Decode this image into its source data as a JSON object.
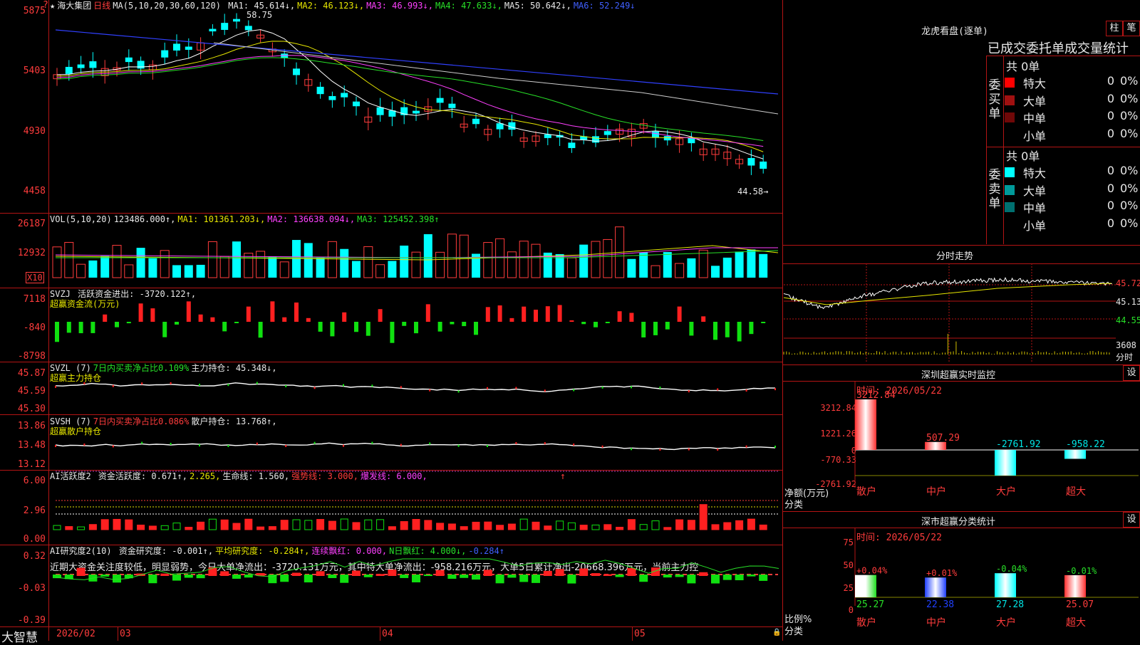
{
  "header_main": {
    "star": "★",
    "stock_name": "海大集团",
    "period": "日线",
    "ma_label": "MA(5,10,20,30,60,120)",
    "ma1": "MA1: 45.614↓,",
    "ma2": "MA2: 46.123↓,",
    "ma3": "MA3: 46.993↓,",
    "ma4": "MA4: 47.633↓,",
    "ma5": "MA5: 50.642↓,",
    "ma6": "MA6: 52.249↓",
    "high_mark": "58.75",
    "low_mark": "44.58→"
  },
  "main_axis": [
    "5875",
    "5403",
    "4930",
    "4458"
  ],
  "vol": {
    "label": "VOL(5,10,20)",
    "value": "123486.000↑,",
    "ma1": "MA1: 101361.203↓,",
    "ma2": "MA2: 136638.094↓,",
    "ma3": "MA3: 125452.398↑",
    "axis": [
      "26187",
      "12932"
    ],
    "unit": "X10"
  },
  "svzj": {
    "label": "SVZJ",
    "line1": "活跃资金进出: -3720.122↑,",
    "line2": "超赢资金流(万元)",
    "axis": [
      "7118",
      "-840",
      "-8798"
    ]
  },
  "svzl": {
    "label": "SVZL (7)",
    "pct": "7日内买卖净占比0.109%",
    "hold": "主力持仓: 45.348↓,",
    "line2": "超赢主力持仓",
    "axis": [
      "45.87",
      "45.59",
      "45.30"
    ]
  },
  "svsh": {
    "label": "SVSH (7)",
    "pct": "7日内买卖净占比0.086%",
    "hold": "散户持仓: 13.768↑,",
    "line2": "超赢散户持仓",
    "axis": [
      "13.86",
      "13.48",
      "13.12"
    ]
  },
  "ai1": {
    "label": "AI活跃度2",
    "v1": "资金活跃度: 0.671↑,",
    "v2": "2.265,",
    "v3": "生命线: 1.560,",
    "v4": "强势线: 3.000,",
    "v5": "爆发线: 6.000,",
    "arrow": "↑",
    "axis": [
      "6.00",
      "2.96",
      "0.00"
    ]
  },
  "ai2": {
    "label": "AI研究度2(10)",
    "v1": "资金研究度: -0.001↑,",
    "v2": "平均研究度: -0.284↑,",
    "v3": "连续飘红: 0.000,",
    "v4": "N日飘红: 4.000↓,",
    "v5": "-0.284↑",
    "sentence": "近期大资金关注度较低，明显弱势，今日大单净流出：-3720.131万元，其中特大单净流出：-958.216万元，大单5日累计净出-20668.396万元，当前主力控",
    "axis": [
      "0.32",
      "-0.03",
      "-0.39"
    ]
  },
  "bottom": {
    "brand": "大智慧",
    "d1": "2026/02",
    "d2": "03",
    "d3": "04",
    "d4": "05",
    "lock": "🔒"
  },
  "lhb": {
    "title": "龙虎看盘(逐单)",
    "btn1": "柱",
    "btn2": "笔",
    "subtitle": "已成交委托单成交量统计",
    "buy_total": "共 0单",
    "buy_label": "委买单",
    "buy_rows": [
      {
        "name": "特大",
        "v": "0",
        "pct": "0%",
        "color": "#ff0000"
      },
      {
        "name": "大单",
        "v": "0",
        "pct": "0%",
        "color": "#a01010"
      },
      {
        "name": "中单",
        "v": "0",
        "pct": "0%",
        "color": "#700808"
      },
      {
        "name": "小单",
        "v": "0",
        "pct": "0%",
        "color": "#000000"
      }
    ],
    "sell_total": "共 0单",
    "sell_label": "委卖单",
    "sell_rows": [
      {
        "name": "特大",
        "v": "0",
        "pct": "0%",
        "color": "#00ffff"
      },
      {
        "name": "大单",
        "v": "0",
        "pct": "0%",
        "color": "#009a9a"
      },
      {
        "name": "中单",
        "v": "0",
        "pct": "0%",
        "color": "#007070"
      },
      {
        "name": "小单",
        "v": "0",
        "pct": "0%",
        "color": "#000000"
      }
    ]
  },
  "fenshi": {
    "title": "分时走势",
    "axis": [
      "45.72",
      "45.13",
      "44.55"
    ],
    "vol_label1": "3608",
    "vol_label2": "分时"
  },
  "monitor": {
    "title": "深圳超赢实时监控",
    "btn": "设",
    "time": "时间: 2026/05/22",
    "axis": [
      "3212.84",
      "1221.26",
      "0",
      "-770.33",
      "-2761.92"
    ],
    "ylabel1": "净额(万元)",
    "ylabel2": "分类",
    "categories": [
      "散户",
      "中户",
      "大户",
      "超大"
    ],
    "values": [
      3212.84,
      507.29,
      -2761.92,
      -958.22
    ],
    "value_labels": [
      "3212.84",
      "507.29",
      "-2761.92",
      "-958.22"
    ]
  },
  "classstat": {
    "title": "深市超赢分类统计",
    "btn": "设",
    "time": "时间: 2026/05/22",
    "axis": [
      "75",
      "50",
      "25",
      "0"
    ],
    "ylabel1": "比例%",
    "ylabel2": "分类",
    "categories": [
      "散户",
      "中户",
      "大户",
      "超大"
    ],
    "values": [
      25.27,
      22.38,
      27.28,
      25.07
    ],
    "changes": [
      "+0.04%",
      "+0.01%",
      "-0.04%",
      "-0.01%"
    ]
  },
  "colors": {
    "up": "#ff3c3c",
    "down": "#00ffff",
    "grid": "#b41414"
  }
}
